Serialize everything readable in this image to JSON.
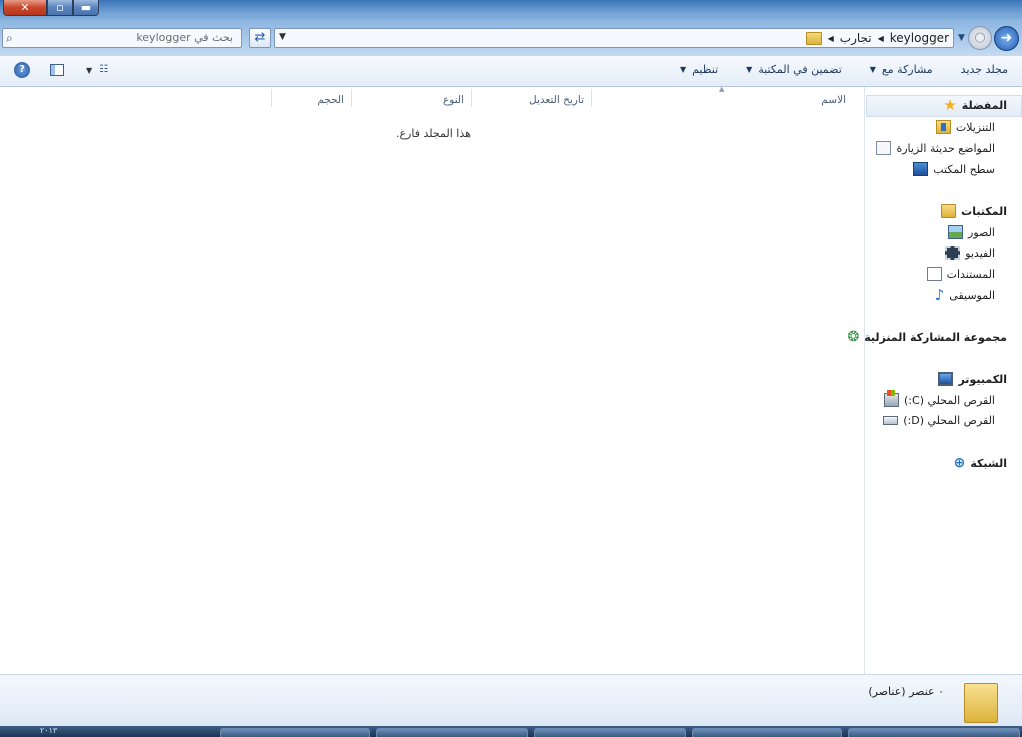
{
  "window": {
    "close_glyph": "✕",
    "max_glyph": "▫",
    "min_glyph": "▬"
  },
  "addressbar": {
    "search_placeholder": "بحث في keylogger",
    "breadcrumbs": [
      "تجارب",
      "keylogger"
    ],
    "refresh_glyph": "⇄",
    "back_glyph": "➜",
    "forward_glyph": "○"
  },
  "toolbar": {
    "organize": "تنظيم",
    "include_in_library": "تضمين في المكتبة",
    "share_with": "مشاركة مع",
    "new_folder": "مجلد جديد",
    "help_glyph": "?"
  },
  "columns": {
    "name": "الاسم",
    "date_modified": "تاريخ التعديل",
    "type": "النوع",
    "size": "الحجم"
  },
  "content": {
    "empty_message": "هذا المجلد فارغ."
  },
  "navpane": {
    "favorites": {
      "label": "المفضلة",
      "items": [
        "التنزيلات",
        "المواضع حديثة الزيارة",
        "سطح المكتب"
      ]
    },
    "libraries": {
      "label": "المكتبات",
      "items": [
        "الصور",
        "الفيديو",
        "المستندات",
        "الموسيقى"
      ]
    },
    "homegroup": {
      "label": "مجموعة المشاركة المنزلية"
    },
    "computer": {
      "label": "الكمبيوتر",
      "items": [
        "القرص المحلي (C:)",
        "القرص المحلي (D:)"
      ]
    },
    "network": {
      "label": "الشبكة"
    }
  },
  "details": {
    "item_count": "٠ عنصر (عناصر)"
  },
  "taskbar": {
    "clock_fragment": "٢٠١٣"
  }
}
